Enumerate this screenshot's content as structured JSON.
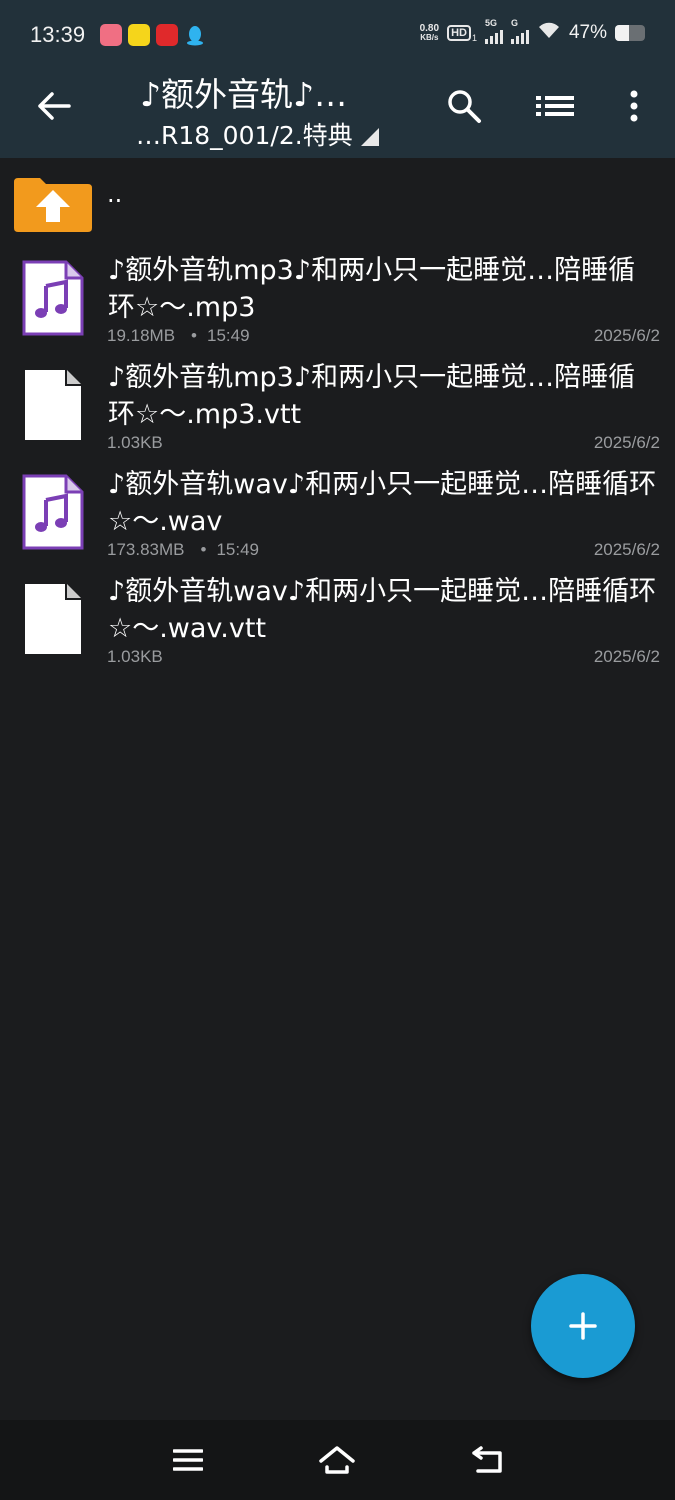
{
  "status_bar": {
    "time": "13:39",
    "net_speed_value": "0.80",
    "net_speed_unit": "KB/s",
    "hd_label": "HD",
    "hd_sub": "1",
    "signal1_label": "5G",
    "signal2_label": "G",
    "battery_percent": "47%",
    "battery_level": 0.47
  },
  "toolbar": {
    "title": "♪额外音轨♪…",
    "subtitle": "…R18_001/2.特典",
    "icons": [
      "back-arrow-icon",
      "search-icon",
      "list-view-icon",
      "more-vert-icon"
    ]
  },
  "parent_dir_label": "..",
  "files": [
    {
      "name": "♪额外音轨mp3♪和两小只一起睡觉…陪睡循环☆～.mp3",
      "size": "19.18MB",
      "time": "15:49",
      "date": "2025/6/2",
      "type": "audio"
    },
    {
      "name": "♪额外音轨mp3♪和两小只一起睡觉…陪睡循环☆～.mp3.vtt",
      "size": "1.03KB",
      "time": "",
      "date": "2025/6/2",
      "type": "text"
    },
    {
      "name": "♪额外音轨wav♪和两小只一起睡觉…陪睡循环☆～.wav",
      "size": "173.83MB",
      "time": "15:49",
      "date": "2025/6/2",
      "type": "audio"
    },
    {
      "name": "♪额外音轨wav♪和两小只一起睡觉…陪睡循环☆～.wav.vtt",
      "size": "1.03KB",
      "time": "",
      "date": "2025/6/2",
      "type": "text"
    }
  ],
  "fab": {
    "icon": "plus-icon"
  },
  "nav": {
    "icons": [
      "menu-icon",
      "home-icon",
      "back-icon"
    ]
  },
  "colors": {
    "toolbar_bg": "#22313a",
    "body_bg": "#1b1c1e",
    "accent": "#1a9bd3",
    "audio_icon": "#7b3fb5",
    "folder": "#f29a1d"
  }
}
